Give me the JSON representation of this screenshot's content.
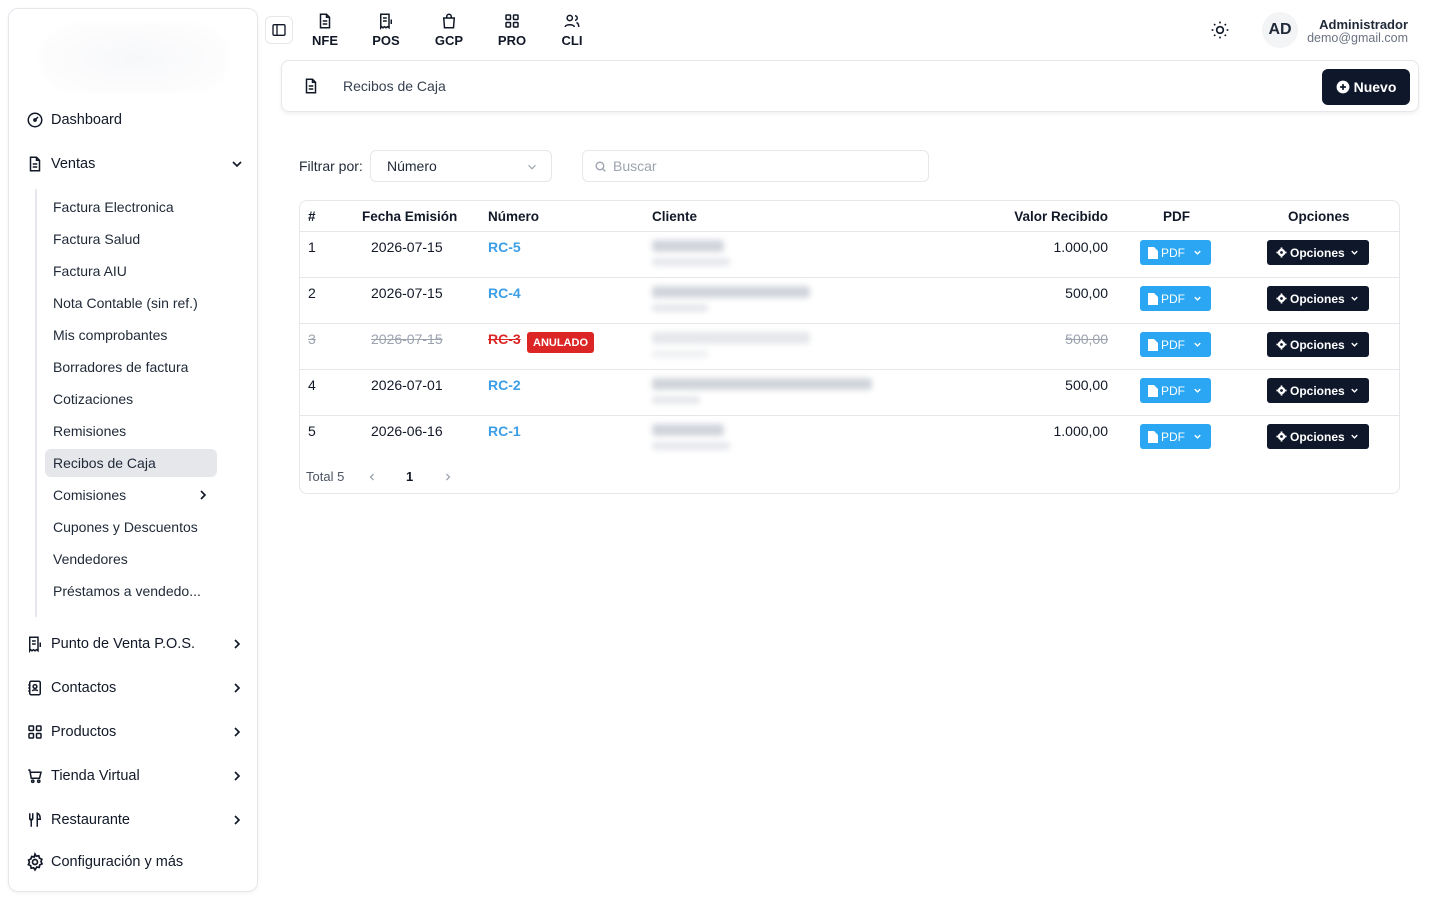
{
  "sidebar": {
    "top_items": [
      {
        "label": "Dashboard",
        "icon": "gauge-icon"
      },
      {
        "label": "Ventas",
        "icon": "document-icon"
      }
    ],
    "ventas_subitems": [
      {
        "label": "Factura Electronica"
      },
      {
        "label": "Factura Salud"
      },
      {
        "label": "Factura AIU"
      },
      {
        "label": "Nota Contable (sin ref.)"
      },
      {
        "label": "Mis comprobantes"
      },
      {
        "label": "Borradores de factura"
      },
      {
        "label": "Cotizaciones"
      },
      {
        "label": "Remisiones"
      },
      {
        "label": "Recibos de Caja",
        "active": true
      },
      {
        "label": "Comisiones"
      },
      {
        "label": "Cupones y Descuentos"
      },
      {
        "label": "Vendedores"
      },
      {
        "label": "Préstamos a vendedo..."
      }
    ],
    "bottom_items": [
      {
        "label": "Punto de Venta P.O.S.",
        "icon": "pos-receipt-icon"
      },
      {
        "label": "Contactos",
        "icon": "contacts-book-icon"
      },
      {
        "label": "Productos",
        "icon": "grid-icon"
      },
      {
        "label": "Tienda Virtual",
        "icon": "cart-icon"
      },
      {
        "label": "Restaurante",
        "icon": "utensils-icon"
      },
      {
        "label": "Configuración y más",
        "icon": "gear-icon"
      }
    ]
  },
  "topbar": {
    "modules": [
      {
        "label": "NFE",
        "icon": "document-icon"
      },
      {
        "label": "POS",
        "icon": "pos-receipt-icon"
      },
      {
        "label": "GCP",
        "icon": "shopping-bag-icon"
      },
      {
        "label": "PRO",
        "icon": "grid-icon"
      },
      {
        "label": "CLI",
        "icon": "users-icon"
      }
    ],
    "user": {
      "initials": "AD",
      "name": "Administrador",
      "email": "demo@gmail.com"
    }
  },
  "page": {
    "title": "Recibos de Caja",
    "new_button": "Nuevo"
  },
  "filters": {
    "label": "Filtrar por:",
    "selected": "Número",
    "search_placeholder": "Buscar"
  },
  "table": {
    "headers": {
      "num": "#",
      "date": "Fecha Emisión",
      "number": "Número",
      "client": "Cliente",
      "value": "Valor Recibido",
      "pdf": "PDF",
      "options": "Opciones"
    },
    "rows": [
      {
        "num": "1",
        "date": "2026-07-15",
        "code": "RC-5",
        "value": "1.000,00",
        "voided": false
      },
      {
        "num": "2",
        "date": "2026-07-15",
        "code": "RC-4",
        "value": "500,00",
        "voided": false
      },
      {
        "num": "3",
        "date": "2026-07-15",
        "code": "RC-3",
        "value": "500,00",
        "voided": true,
        "badge": "ANULADO"
      },
      {
        "num": "4",
        "date": "2026-07-01",
        "code": "RC-2",
        "value": "500,00",
        "voided": false
      },
      {
        "num": "5",
        "date": "2026-06-16",
        "code": "RC-1",
        "value": "1.000,00",
        "voided": false
      }
    ],
    "pdf_label": "PDF",
    "options_label": "Opciones"
  },
  "pagination": {
    "total_label": "Total 5",
    "current_page": "1"
  },
  "colors": {
    "accent": "#2ba6f2",
    "dark": "#0f172a",
    "danger": "#dc2626",
    "link": "#3b9ee6"
  }
}
